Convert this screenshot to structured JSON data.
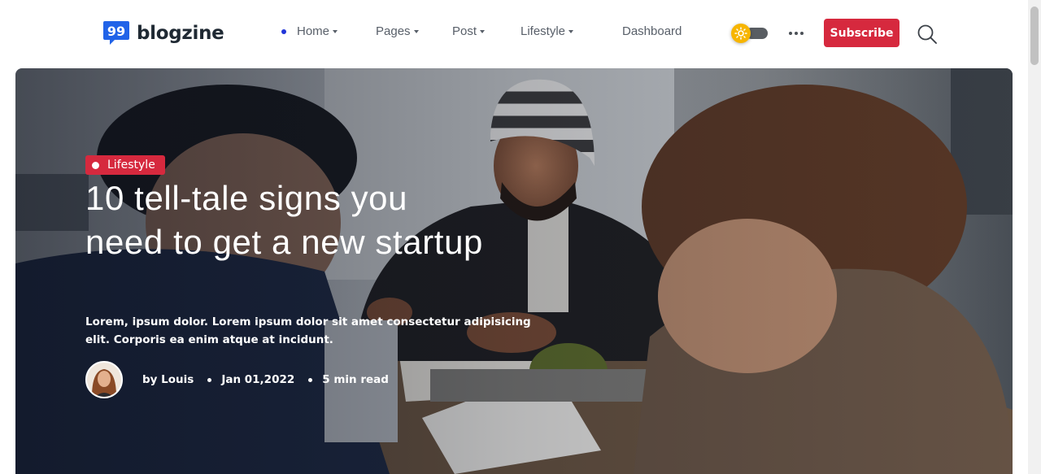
{
  "brand": {
    "name": "blogzine",
    "logo_icon": "speech-bubble-quote-icon",
    "color": "#2163e8"
  },
  "nav": {
    "items": [
      {
        "label": "Home",
        "dropdown": true,
        "active": true
      },
      {
        "label": "Pages",
        "dropdown": true
      },
      {
        "label": "Post",
        "dropdown": true
      },
      {
        "label": "Lifestyle",
        "dropdown": true
      },
      {
        "label": "Dashboard",
        "dropdown": false
      }
    ],
    "active_color": "#2135d9"
  },
  "header_actions": {
    "theme_toggle": {
      "icon": "sun-icon",
      "mode": "light"
    },
    "more_icon": "ellipsis-icon",
    "subscribe_label": "Subscribe",
    "subscribe_color": "#d6293e",
    "search_icon": "search-icon"
  },
  "hero": {
    "category": "Lifestyle",
    "title": "10 tell-tale signs you need to get a new startup",
    "description": "Lorem, ipsum dolor. Lorem ipsum dolor sit amet consectetur adipisicing elit. Corporis ea enim atque at incidunt.",
    "author": "by Louis",
    "date": "Jan 01,2022",
    "read_time": "5 min read"
  }
}
